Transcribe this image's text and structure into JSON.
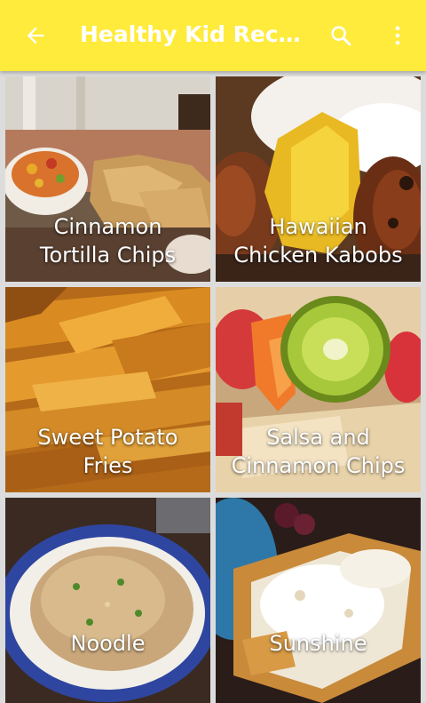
{
  "appbar": {
    "title": "Healthy Kid Reci...",
    "background": "#ffeb3b"
  },
  "icons": {
    "back": "arrow-back-icon",
    "search": "search-icon",
    "more": "more-vert-icon"
  },
  "recipes": [
    {
      "label_line1": "Cinnamon",
      "label_line2": "Tortilla Chips"
    },
    {
      "label_line1": "Hawaiian",
      "label_line2": "Chicken Kabobs"
    },
    {
      "label_line1": "Sweet Potato",
      "label_line2": "Fries"
    },
    {
      "label_line1": "Salsa and",
      "label_line2": "Cinnamon Chips"
    },
    {
      "label_line1": "Noodle",
      "label_line2": ""
    },
    {
      "label_line1": "Sunshine",
      "label_line2": ""
    }
  ]
}
